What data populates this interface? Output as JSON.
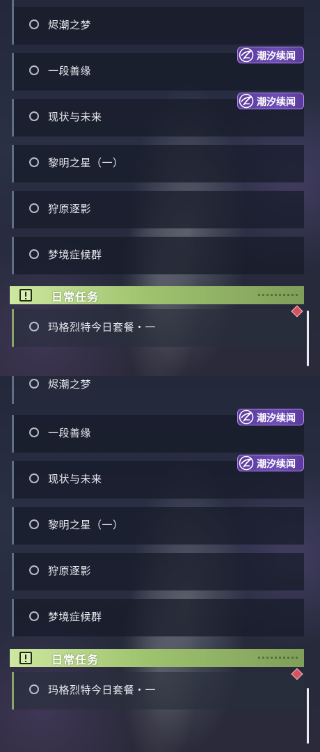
{
  "story_quests": [
    {
      "label": "烬潮之梦"
    },
    {
      "label": "一段善缘"
    },
    {
      "label": "现状与未来"
    },
    {
      "label": "黎明之星（一）"
    },
    {
      "label": "狩原逐影"
    },
    {
      "label": "梦境症候群"
    }
  ],
  "badges": [
    {
      "text": "潮汐续闻"
    },
    {
      "text": "潮汐续闻"
    }
  ],
  "daily_section": {
    "title": "日常任务"
  },
  "daily_quests": [
    {
      "label": "玛格烈特今日套餐・一"
    }
  ],
  "colors": {
    "badge_purple": "#6d4db8",
    "section_green": "#9fc46f",
    "new_marker": "#d9505f"
  }
}
